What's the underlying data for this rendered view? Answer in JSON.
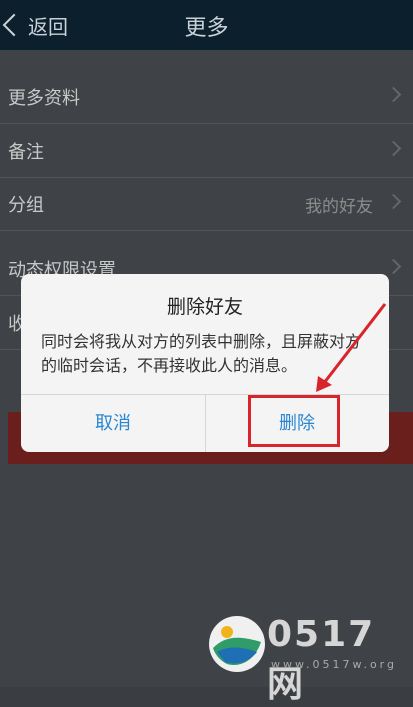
{
  "header": {
    "back_label": "返回",
    "title": "更多"
  },
  "rows": [
    {
      "label": "更多资料",
      "value": ""
    },
    {
      "label": "备注",
      "value": ""
    },
    {
      "label": "分组",
      "value": "我的好友"
    },
    {
      "label": "动态权限设置",
      "value": ""
    },
    {
      "label": "收",
      "value": ""
    }
  ],
  "dialog": {
    "title": "删除好友",
    "message": "同时会将我从对方的列表中删除，且屏蔽对方的临时会话，不再接收此人的消息。",
    "cancel_label": "取消",
    "delete_label": "删除"
  },
  "watermark": {
    "brand": "0517网",
    "url": "www.0517w.org"
  },
  "colors": {
    "header_bg": "#0b1f2d",
    "dialog_button": "#2a86d1",
    "highlight": "#d8242b"
  }
}
